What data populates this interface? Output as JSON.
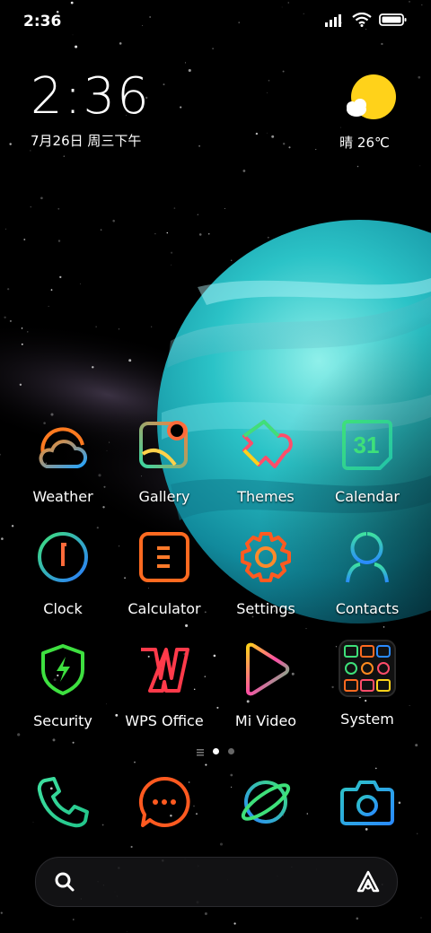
{
  "status_bar": {
    "time": "2:36",
    "icons": [
      "signal-icon",
      "wifi-icon",
      "battery-icon"
    ]
  },
  "clock_widget": {
    "time": "2:36",
    "date": "7月26日 周三下午"
  },
  "weather_widget": {
    "condition_icon": "sunny-cloud-icon",
    "text": "晴 26℃"
  },
  "apps": [
    {
      "label": "Weather",
      "icon": "weather-icon"
    },
    {
      "label": "Gallery",
      "icon": "gallery-icon"
    },
    {
      "label": "Themes",
      "icon": "themes-icon"
    },
    {
      "label": "Calendar",
      "icon": "calendar-icon",
      "icon_text": "31"
    },
    {
      "label": "Clock",
      "icon": "clock-icon"
    },
    {
      "label": "Calculator",
      "icon": "calculator-icon"
    },
    {
      "label": "Settings",
      "icon": "settings-icon"
    },
    {
      "label": "Contacts",
      "icon": "contacts-icon"
    },
    {
      "label": "Security",
      "icon": "security-icon"
    },
    {
      "label": "WPS Office",
      "icon": "wps-office-icon"
    },
    {
      "label": "Mi Video",
      "icon": "mi-video-icon"
    },
    {
      "label": "System",
      "icon": "system-folder-icon"
    }
  ],
  "page_indicator": {
    "pages": 3,
    "current": 2
  },
  "dock": [
    {
      "icon": "phone-icon"
    },
    {
      "icon": "messages-icon"
    },
    {
      "icon": "browser-icon"
    },
    {
      "icon": "camera-icon"
    }
  ],
  "search_bar": {
    "left_icon": "search-icon",
    "right_icon": "assistant-icon"
  },
  "colors": {
    "background": "#000000",
    "planet": "#2ec4c4",
    "sun": "#ffd21a"
  }
}
